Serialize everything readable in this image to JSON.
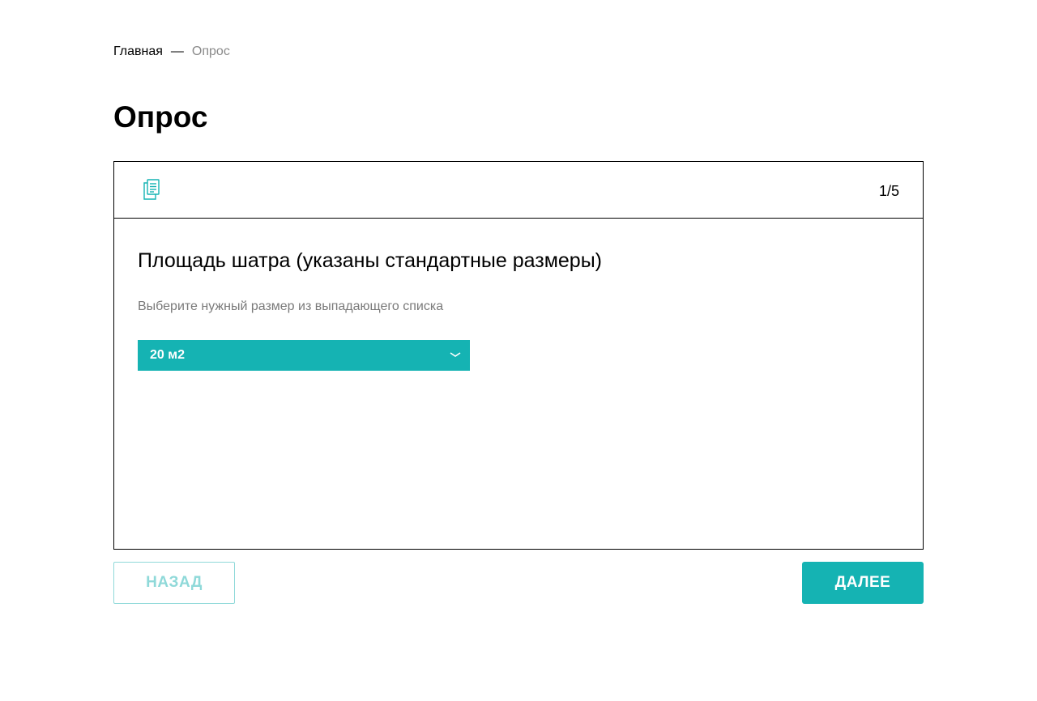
{
  "breadcrumb": {
    "home": "Главная",
    "separator": "—",
    "current": "Опрос"
  },
  "page": {
    "title": "Опрос"
  },
  "survey": {
    "icon": "document-icon",
    "step": "1/5",
    "question": "Площадь шатра (указаны стандартные размеры)",
    "hint": "Выберите нужный размер из выпадающего списка",
    "select": {
      "value": "20 м2",
      "icon": "chevron-down-icon"
    }
  },
  "buttons": {
    "back": "НАЗАД",
    "next": "ДАЛЕЕ"
  },
  "colors": {
    "accent": "#15b3b3",
    "accent_light": "#8fd9d9",
    "muted_text": "#7a7a7a"
  }
}
